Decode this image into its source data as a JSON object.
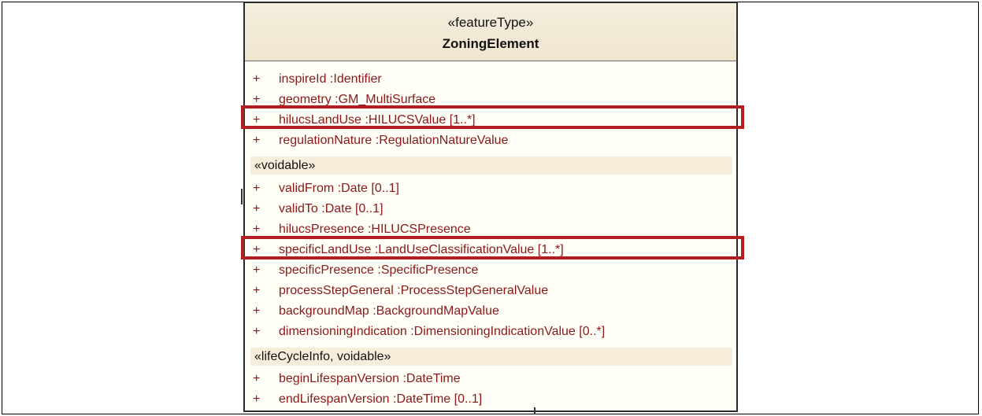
{
  "class": {
    "stereotype": "«featureType»",
    "name": "ZoningElement"
  },
  "attributes": [
    {
      "vis": "+",
      "text": "inspireId  :Identifier"
    },
    {
      "vis": "+",
      "text": "geometry  :GM_MultiSurface"
    },
    {
      "vis": "+",
      "text": "hilucsLandUse  :HILUCSValue [1..*]"
    },
    {
      "vis": "+",
      "text": "regulationNature  :RegulationNatureValue"
    }
  ],
  "sections": [
    {
      "label": "«voidable»",
      "attributes": [
        {
          "vis": "+",
          "text": "validFrom  :Date [0..1]"
        },
        {
          "vis": "+",
          "text": "validTo  :Date [0..1]"
        },
        {
          "vis": "+",
          "text": "hilucsPresence  :HILUCSPresence"
        },
        {
          "vis": "+",
          "text": "specificLandUse  :LandUseClassificationValue [1..*]"
        },
        {
          "vis": "+",
          "text": "specificPresence  :SpecificPresence"
        },
        {
          "vis": "+",
          "text": "processStepGeneral  :ProcessStepGeneralValue"
        },
        {
          "vis": "+",
          "text": "backgroundMap  :BackgroundMapValue"
        },
        {
          "vis": "+",
          "text": "dimensioningIndication  :DimensioningIndicationValue [0..*]"
        }
      ]
    },
    {
      "label": "«lifeCycleInfo, voidable»",
      "attributes": [
        {
          "vis": "+",
          "text": "beginLifespanVersion  :DateTime"
        },
        {
          "vis": "+",
          "text": "endLifespanVersion  :DateTime [0..1]"
        }
      ]
    }
  ],
  "highlighted": [
    "hilucsLandUse",
    "specificLandUse"
  ],
  "colors": {
    "attribute_text": "#8b1818",
    "highlight_border": "#b21f22",
    "header_fill": "#f1e9d5",
    "section_fill": "#f6eedb"
  }
}
